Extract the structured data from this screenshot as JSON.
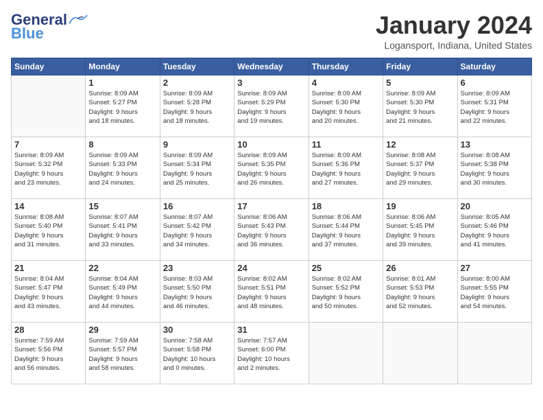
{
  "header": {
    "logo_general": "General",
    "logo_blue": "Blue",
    "month": "January 2024",
    "location": "Logansport, Indiana, United States"
  },
  "days_of_week": [
    "Sunday",
    "Monday",
    "Tuesday",
    "Wednesday",
    "Thursday",
    "Friday",
    "Saturday"
  ],
  "weeks": [
    [
      {
        "day": "",
        "info": ""
      },
      {
        "day": "1",
        "info": "Sunrise: 8:09 AM\nSunset: 5:27 PM\nDaylight: 9 hours\nand 18 minutes."
      },
      {
        "day": "2",
        "info": "Sunrise: 8:09 AM\nSunset: 5:28 PM\nDaylight: 9 hours\nand 18 minutes."
      },
      {
        "day": "3",
        "info": "Sunrise: 8:09 AM\nSunset: 5:29 PM\nDaylight: 9 hours\nand 19 minutes."
      },
      {
        "day": "4",
        "info": "Sunrise: 8:09 AM\nSunset: 5:30 PM\nDaylight: 9 hours\nand 20 minutes."
      },
      {
        "day": "5",
        "info": "Sunrise: 8:09 AM\nSunset: 5:30 PM\nDaylight: 9 hours\nand 21 minutes."
      },
      {
        "day": "6",
        "info": "Sunrise: 8:09 AM\nSunset: 5:31 PM\nDaylight: 9 hours\nand 22 minutes."
      }
    ],
    [
      {
        "day": "7",
        "info": "Sunrise: 8:09 AM\nSunset: 5:32 PM\nDaylight: 9 hours\nand 23 minutes."
      },
      {
        "day": "8",
        "info": "Sunrise: 8:09 AM\nSunset: 5:33 PM\nDaylight: 9 hours\nand 24 minutes."
      },
      {
        "day": "9",
        "info": "Sunrise: 8:09 AM\nSunset: 5:34 PM\nDaylight: 9 hours\nand 25 minutes."
      },
      {
        "day": "10",
        "info": "Sunrise: 8:09 AM\nSunset: 5:35 PM\nDaylight: 9 hours\nand 26 minutes."
      },
      {
        "day": "11",
        "info": "Sunrise: 8:09 AM\nSunset: 5:36 PM\nDaylight: 9 hours\nand 27 minutes."
      },
      {
        "day": "12",
        "info": "Sunrise: 8:08 AM\nSunset: 5:37 PM\nDaylight: 9 hours\nand 29 minutes."
      },
      {
        "day": "13",
        "info": "Sunrise: 8:08 AM\nSunset: 5:38 PM\nDaylight: 9 hours\nand 30 minutes."
      }
    ],
    [
      {
        "day": "14",
        "info": "Sunrise: 8:08 AM\nSunset: 5:40 PM\nDaylight: 9 hours\nand 31 minutes."
      },
      {
        "day": "15",
        "info": "Sunrise: 8:07 AM\nSunset: 5:41 PM\nDaylight: 9 hours\nand 33 minutes."
      },
      {
        "day": "16",
        "info": "Sunrise: 8:07 AM\nSunset: 5:42 PM\nDaylight: 9 hours\nand 34 minutes."
      },
      {
        "day": "17",
        "info": "Sunrise: 8:06 AM\nSunset: 5:43 PM\nDaylight: 9 hours\nand 36 minutes."
      },
      {
        "day": "18",
        "info": "Sunrise: 8:06 AM\nSunset: 5:44 PM\nDaylight: 9 hours\nand 37 minutes."
      },
      {
        "day": "19",
        "info": "Sunrise: 8:06 AM\nSunset: 5:45 PM\nDaylight: 9 hours\nand 39 minutes."
      },
      {
        "day": "20",
        "info": "Sunrise: 8:05 AM\nSunset: 5:46 PM\nDaylight: 9 hours\nand 41 minutes."
      }
    ],
    [
      {
        "day": "21",
        "info": "Sunrise: 8:04 AM\nSunset: 5:47 PM\nDaylight: 9 hours\nand 43 minutes."
      },
      {
        "day": "22",
        "info": "Sunrise: 8:04 AM\nSunset: 5:49 PM\nDaylight: 9 hours\nand 44 minutes."
      },
      {
        "day": "23",
        "info": "Sunrise: 8:03 AM\nSunset: 5:50 PM\nDaylight: 9 hours\nand 46 minutes."
      },
      {
        "day": "24",
        "info": "Sunrise: 8:02 AM\nSunset: 5:51 PM\nDaylight: 9 hours\nand 48 minutes."
      },
      {
        "day": "25",
        "info": "Sunrise: 8:02 AM\nSunset: 5:52 PM\nDaylight: 9 hours\nand 50 minutes."
      },
      {
        "day": "26",
        "info": "Sunrise: 8:01 AM\nSunset: 5:53 PM\nDaylight: 9 hours\nand 52 minutes."
      },
      {
        "day": "27",
        "info": "Sunrise: 8:00 AM\nSunset: 5:55 PM\nDaylight: 9 hours\nand 54 minutes."
      }
    ],
    [
      {
        "day": "28",
        "info": "Sunrise: 7:59 AM\nSunset: 5:56 PM\nDaylight: 9 hours\nand 56 minutes."
      },
      {
        "day": "29",
        "info": "Sunrise: 7:59 AM\nSunset: 5:57 PM\nDaylight: 9 hours\nand 58 minutes."
      },
      {
        "day": "30",
        "info": "Sunrise: 7:58 AM\nSunset: 5:58 PM\nDaylight: 10 hours\nand 0 minutes."
      },
      {
        "day": "31",
        "info": "Sunrise: 7:57 AM\nSunset: 6:00 PM\nDaylight: 10 hours\nand 2 minutes."
      },
      {
        "day": "",
        "info": ""
      },
      {
        "day": "",
        "info": ""
      },
      {
        "day": "",
        "info": ""
      }
    ]
  ]
}
